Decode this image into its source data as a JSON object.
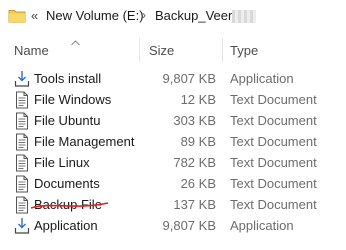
{
  "breadcrumb": {
    "overflow": "«",
    "segments": [
      "New Volume (E:)",
      "Backup_Veem"
    ],
    "separator": "›"
  },
  "columns": {
    "name": "Name",
    "size": "Size",
    "type": "Type"
  },
  "files": [
    {
      "name": "Tools install",
      "size": "9,807 KB",
      "type": "Application",
      "icon": "installer-icon"
    },
    {
      "name": "File Windows",
      "size": "12 KB",
      "type": "Text Document",
      "icon": "text-document-icon"
    },
    {
      "name": "File Ubuntu",
      "size": "303 KB",
      "type": "Text Document",
      "icon": "text-document-icon"
    },
    {
      "name": "File Management",
      "size": "89 KB",
      "type": "Text Document",
      "icon": "text-document-icon"
    },
    {
      "name": "File Linux",
      "size": "782 KB",
      "type": "Text Document",
      "icon": "text-document-icon"
    },
    {
      "name": "Documents",
      "size": "26 KB",
      "type": "Text Document",
      "icon": "text-document-icon"
    },
    {
      "name": "Backup File",
      "size": "137 KB",
      "type": "Text Document",
      "icon": "text-document-icon",
      "struck_through": true
    },
    {
      "name": "Application",
      "size": "9,807 KB",
      "type": "Application",
      "icon": "installer-icon"
    }
  ],
  "colors": {
    "folder": "#f2c94c",
    "strike": "#e02020",
    "secondary_text": "#6d6d6d"
  }
}
